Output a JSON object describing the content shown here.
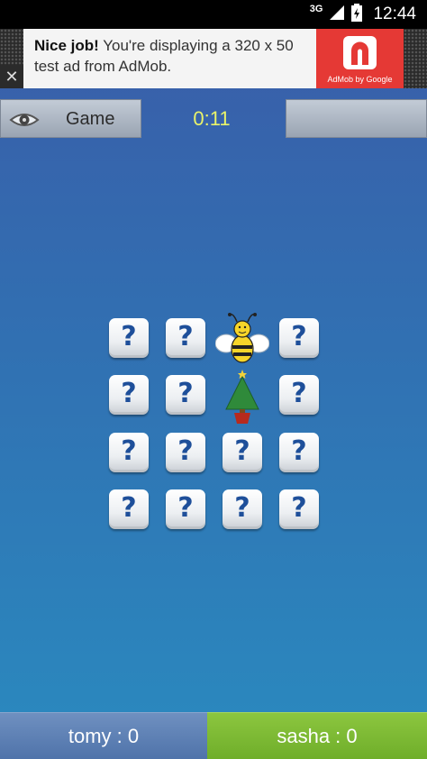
{
  "status_bar": {
    "network": "3G",
    "time": "12:44",
    "signal_icon": "signal-icon",
    "battery_icon": "battery-icon"
  },
  "ad": {
    "headline": "Nice job!",
    "body": " You're displaying a 320 x 50 test ad from AdMob.",
    "logo_caption": "AdMob by Google",
    "close_label": "✕",
    "logo_color": "#e53935"
  },
  "header": {
    "menu_icon": "eye-icon",
    "menu_label": "Game",
    "timer": "0:11",
    "timer_color": "#e9f36a"
  },
  "board": {
    "rows": 4,
    "cols": 4,
    "hidden_symbol": "?",
    "tiles": [
      [
        "hidden",
        "hidden",
        "bee",
        "hidden"
      ],
      [
        "hidden",
        "hidden",
        "christmas-tree",
        "hidden"
      ],
      [
        "hidden",
        "hidden",
        "hidden",
        "hidden"
      ],
      [
        "hidden",
        "hidden",
        "hidden",
        "hidden"
      ]
    ]
  },
  "scores": {
    "player1": "tomy : 0",
    "player2": "sasha : 0",
    "player1_color": "#5a7db3",
    "player2_color": "#7cba34"
  }
}
